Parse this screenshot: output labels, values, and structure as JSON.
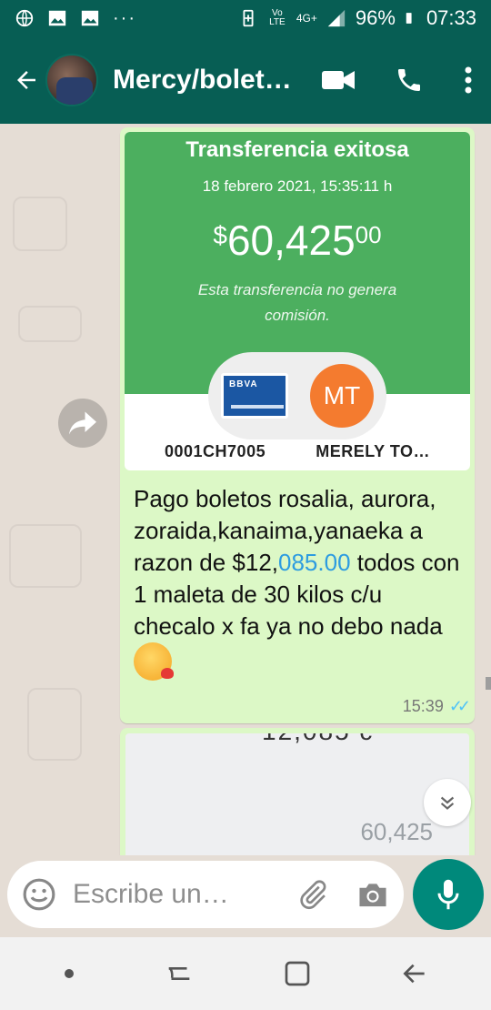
{
  "status_bar": {
    "signal_label": "Vo LTE",
    "network": "4G+",
    "battery": "96%",
    "time": "07:33",
    "icons": [
      "globe-icon",
      "image-icon",
      "image-icon",
      "more-dots-icon",
      "battery-saver-icon",
      "signal-icon",
      "battery-icon"
    ]
  },
  "header": {
    "contact_name": "Mercy/bolet…",
    "icons": [
      "back-arrow-icon",
      "video-call-icon",
      "phone-icon",
      "overflow-menu-icon"
    ]
  },
  "messages": [
    {
      "type": "image",
      "receipt": {
        "title": "Transferencia exitosa",
        "date": "18 febrero 2021, 15:35:11 h",
        "amount_currency": "$",
        "amount_whole": "60,425",
        "amount_cents": "00",
        "note": "Esta transferencia no genera comisión.",
        "bank_card_label": "BBVA",
        "recipient_initials": "MT",
        "account_label": "0001CH7005",
        "recipient_label": "MERELY TO…"
      },
      "text_before_link": "Pago boletos rosalia, aurora, zoraida,kanaima,yanaeka a razon de $12,",
      "text_link": "085.00",
      "text_after_link": " todos con 1 maleta de 30 kilos c/u checalo x fa ya no debo nada",
      "time": "15:39"
    },
    {
      "type": "image",
      "top_cut_text": "12,085 c",
      "visible_number": "60,425"
    }
  ],
  "input": {
    "placeholder": "Escribe un…"
  },
  "colors": {
    "header": "#075e54",
    "bubble_out": "#dcf8c6",
    "receipt_green": "#4caf5f",
    "mic_button": "#00897b",
    "link": "#2d9ce0"
  }
}
